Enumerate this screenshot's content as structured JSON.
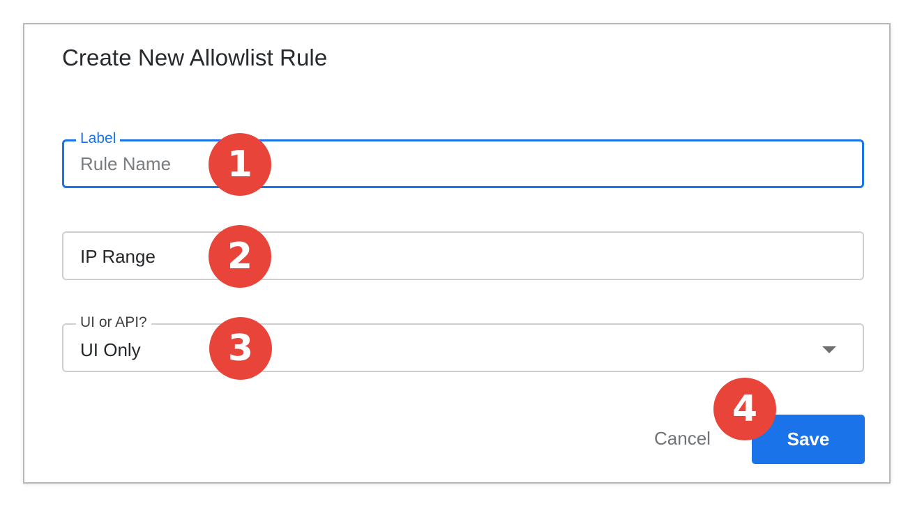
{
  "dialog": {
    "title": "Create New Allowlist Rule",
    "cancel_label": "Cancel",
    "save_label": "Save"
  },
  "fields": {
    "rule_name": {
      "label": "Label",
      "placeholder": "Rule Name"
    },
    "ip_range": {
      "placeholder": "IP Range"
    },
    "ui_or_api": {
      "label": "UI or API?",
      "value": "UI Only"
    }
  },
  "callouts": [
    "1",
    "2",
    "3",
    "4"
  ],
  "colors": {
    "accent": "#1a73e8",
    "callout": "#e8443a",
    "border": "#cfcfcf"
  },
  "icons": {
    "select_caret": "caret-down-icon"
  }
}
